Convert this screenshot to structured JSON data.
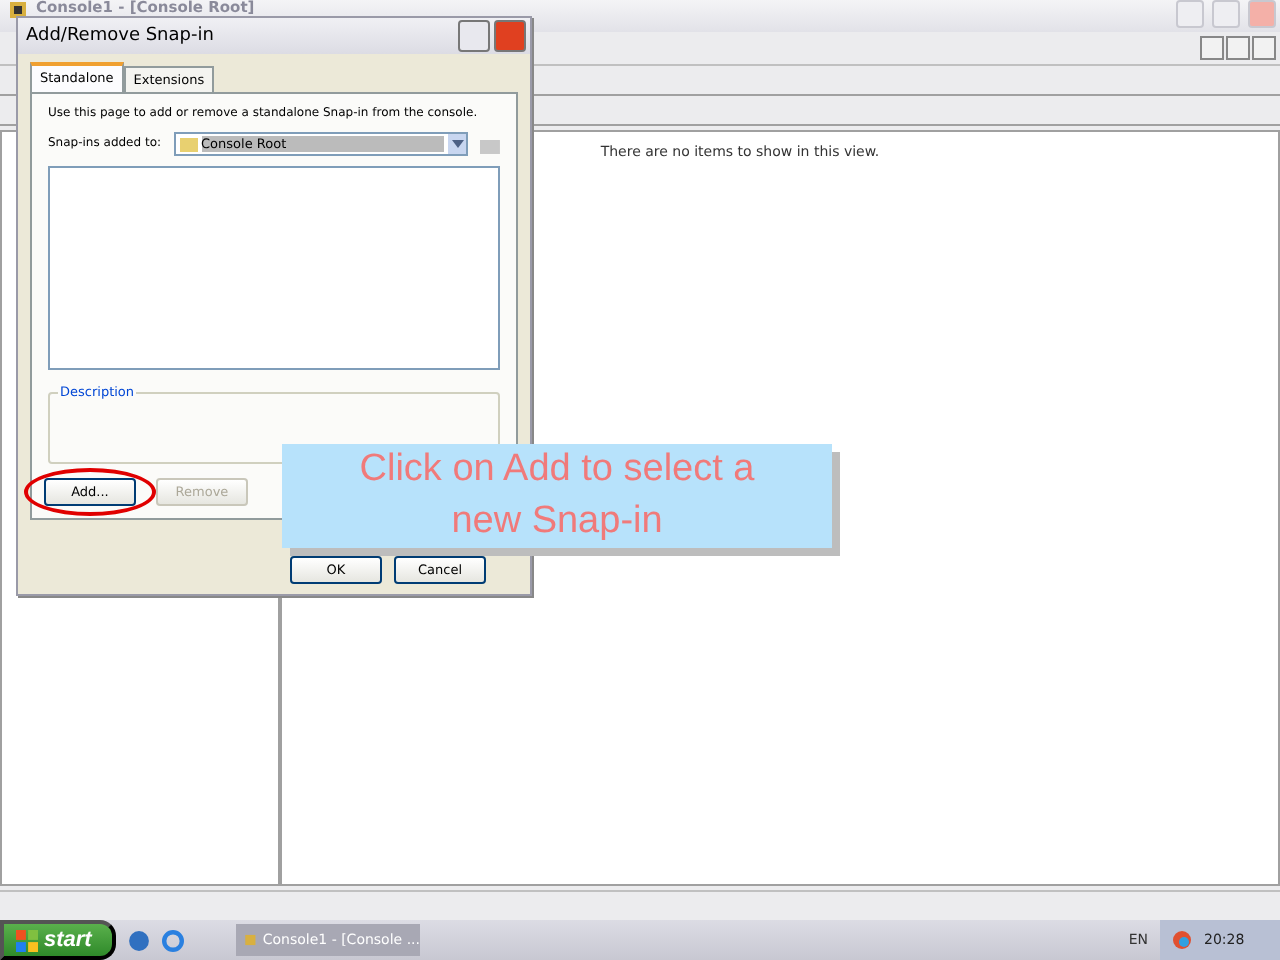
{
  "main_window": {
    "title": "Console1 - [Console Root]",
    "empty_message": "There are no items to show in this view."
  },
  "dialog": {
    "title": "Add/Remove Snap-in",
    "tabs": [
      {
        "label": "Standalone",
        "selected": true
      },
      {
        "label": "Extensions",
        "selected": false
      }
    ],
    "instruction": "Use this page to add or remove a standalone Snap-in from the console.",
    "snapins_label": "Snap-ins added to:",
    "snapins_value": "Console Root",
    "description_label": "Description",
    "buttons": [
      {
        "label": "Add...",
        "disabled": false,
        "highlighted": true
      },
      {
        "label": "Remove",
        "disabled": true,
        "highlighted": false
      }
    ],
    "footer_buttons": [
      {
        "label": "OK"
      },
      {
        "label": "Cancel"
      }
    ]
  },
  "callout": {
    "text": "Click on Add to select a new Snap-in"
  },
  "taskbar": {
    "start": "start",
    "task": "Console1 - [Console ...",
    "language": "EN",
    "clock": "20:28"
  }
}
